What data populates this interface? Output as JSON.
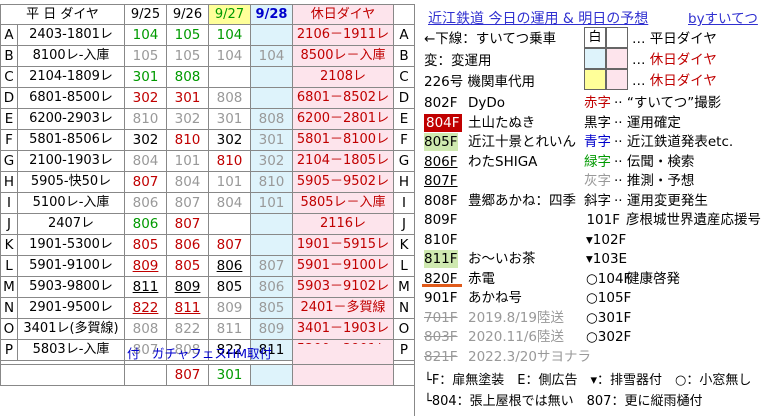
{
  "header": {
    "code": "平 日 ダイヤ",
    "d1": "9/25",
    "d2": "9/26",
    "d3": "9/27",
    "d4": "9/28",
    "holiday": "休日ダイヤ"
  },
  "rows": [
    {
      "code": "A",
      "train": "2403-1801レ",
      "v1": "104",
      "v2": "105",
      "v3": "104",
      "v4": "",
      "hol": "2106－1911レ",
      "side": "A",
      "c1": "gr",
      "c2": "gr",
      "c3": "gr",
      "u1": false,
      "u2": false,
      "u3": false,
      "hc": "r"
    },
    {
      "code": "B",
      "train": "8100レ-入庫",
      "v1": "105",
      "v2": "105",
      "v3": "104",
      "v4": "104",
      "hol": "8500レ－入庫",
      "side": "B",
      "c1": "g",
      "c2": "g",
      "c3": "g",
      "c4": "g",
      "u1": false,
      "u2": false,
      "u3": false,
      "hc": "r"
    },
    {
      "code": "C",
      "train": "2104-1809レ",
      "v1": "301",
      "v2": "808",
      "v3": "",
      "v4": "",
      "hol": "2108レ",
      "side": "C",
      "c1": "gr",
      "c2": "gr",
      "u1": false,
      "u2": false,
      "u3": false,
      "hc": "r"
    },
    {
      "code": "D",
      "train": "6801-8500レ",
      "v1": "302",
      "v2": "301",
      "v3": "808",
      "v4": "",
      "hol": "6801－8502レ",
      "side": "D",
      "c1": "r",
      "c2": "r",
      "c3": "g",
      "u1": false,
      "u2": false,
      "u3": false,
      "hc": "r"
    },
    {
      "code": "E",
      "train": "6200-2903レ",
      "v1": "810",
      "v2": "302",
      "v3": "301",
      "v4": "808",
      "hol": "6200－2801レ",
      "side": "E",
      "c1": "g",
      "c2": "g",
      "c3": "g",
      "c4": "g",
      "u1": false,
      "u2": false,
      "u3": false,
      "hc": "r"
    },
    {
      "code": "F",
      "train": "5801-8506レ",
      "v1": "302",
      "v2": "810",
      "v3": "302",
      "v4": "301",
      "hol": "5801－8100レ",
      "side": "F",
      "c1": "bk",
      "c2": "r",
      "c3": "bk",
      "c4": "g",
      "u1": false,
      "u2": false,
      "u3": false,
      "hc": "r"
    },
    {
      "code": "G",
      "train": "2100-1903レ",
      "v1": "804",
      "v2": "101",
      "v3": "810",
      "v4": "302",
      "hol": "2104－1805レ",
      "side": "G",
      "c1": "g",
      "c2": "g",
      "c3": "r",
      "c4": "g",
      "u1": false,
      "u2": false,
      "u3": false,
      "hc": "r"
    },
    {
      "code": "H",
      "train": "5905-快50レ",
      "v1": "807",
      "v2": "804",
      "v3": "101",
      "v4": "810",
      "hol": "5905－9502レ",
      "side": "H",
      "c1": "r",
      "c2": "g",
      "c3": "g",
      "c4": "g",
      "u1": false,
      "u2": false,
      "u3": false,
      "hc": "r"
    },
    {
      "code": "I",
      "train": "5100レ-入庫",
      "v1": "806",
      "v2": "807",
      "v3": "804",
      "v4": "101",
      "hol": "5805レ－入庫",
      "side": "I",
      "c1": "g",
      "c2": "g",
      "c3": "g",
      "c4": "g",
      "u1": false,
      "u2": false,
      "u3": false,
      "hc": "r"
    },
    {
      "code": "J",
      "train": "2407レ",
      "v1": "806",
      "v2": "807",
      "v3": "",
      "v4": "",
      "hol": "2116レ",
      "side": "J",
      "c1": "gr",
      "c2": "r",
      "u1": false,
      "u2": false,
      "u3": false,
      "hc": "r"
    },
    {
      "code": "K",
      "train": "1901-5300レ",
      "v1": "805",
      "v2": "806",
      "v3": "807",
      "v4": "",
      "hol": "1901－5915レ",
      "side": "K",
      "c1": "r",
      "c2": "r",
      "c3": "r",
      "u1": false,
      "u2": false,
      "u3": false,
      "hc": "r"
    },
    {
      "code": "L",
      "train": "5901-9100レ",
      "v1": "809",
      "v2": "805",
      "v3": "806",
      "v4": "807",
      "hol": "5901－9100レ",
      "side": "L",
      "c1": "r",
      "c2": "r",
      "c3": "bk",
      "c4": "g",
      "u1": true,
      "u2": false,
      "u3": true,
      "hc": "r"
    },
    {
      "code": "M",
      "train": "5903-9800レ",
      "v1": "811",
      "v2": "809",
      "v3": "805",
      "v4": "806",
      "hol": "5903－9102レ",
      "side": "M",
      "c1": "bk",
      "c2": "bk",
      "c3": "bk",
      "c4": "g",
      "u1": true,
      "u2": true,
      "u3": false,
      "hc": "r"
    },
    {
      "code": "N",
      "train": "2901-9500レ",
      "v1": "822",
      "v2": "811",
      "v3": "809",
      "v4": "805",
      "hol": "2401－多賀線",
      "side": "N",
      "c1": "r",
      "c2": "r",
      "c3": "g",
      "c4": "g",
      "u1": true,
      "u2": true,
      "u3": false,
      "hc": "r"
    },
    {
      "code": "O",
      "train": "3401レ(多賀線)",
      "v1": "808",
      "v2": "822",
      "v3": "811",
      "v4": "809",
      "hol": "3401－1903レ",
      "side": "O",
      "c1": "g",
      "c2": "g",
      "c3": "g",
      "c4": "g",
      "u1": false,
      "u2": false,
      "u3": false,
      "hc": "r"
    },
    {
      "code": "P",
      "train": "5803レ-入庫",
      "v1": "807",
      "v2": "808",
      "v3": "822",
      "v4": "811",
      "hol": "5200－2901レ",
      "side": "P",
      "c1": "g",
      "c2": "g",
      "c3": "bk",
      "c4": "bk",
      "u1": false,
      "u2": false,
      "u3": false,
      "hc": "r"
    }
  ],
  "footer_note": "付　ガチャフェスHM取付",
  "footer_vals": {
    "v2": "807",
    "v3": "301"
  },
  "right": {
    "title": "近江鉄道 今日の運用 & 明日の予想",
    "author": "byすいてつ",
    "legend": {
      "down": "←下線：すいてつ乗車",
      "change": "変：変運用",
      "sub": "226号 機関車代用",
      "shiro": "白",
      "weekday": "平日ダイヤ",
      "holiday1": "休日ダイヤ",
      "holiday2": "休日ダイヤ"
    },
    "cars": [
      {
        "num": "802F",
        "label": "DyDo"
      },
      {
        "num": "804F",
        "label": "土山たぬき"
      },
      {
        "num": "805F",
        "label": "近江十景とれいん"
      },
      {
        "num": "806F",
        "label": "わたSHIGA"
      },
      {
        "num": "807F",
        "label": ""
      },
      {
        "num": "808F",
        "label": "豊郷あかね：四季"
      },
      {
        "num": "809F",
        "label": ""
      },
      {
        "num": "810F",
        "label": ""
      },
      {
        "num": "811F",
        "label": "お〜いお茶"
      },
      {
        "num": "820F",
        "label": "赤電"
      },
      {
        "num": "901F",
        "label": "あかね号"
      },
      {
        "num": "701F",
        "label": "2019.8/19陸送"
      },
      {
        "num": "803F",
        "label": "2020.11/6陸送"
      },
      {
        "num": "821F",
        "label": "2022.3/20サヨナラ"
      }
    ],
    "colors": [
      {
        "key": "赤字",
        "desc": "“すいてつ”撮影"
      },
      {
        "key": "黒字",
        "desc": "運用確定"
      },
      {
        "key": "青字",
        "desc": "近江鉄道発表etc."
      },
      {
        "key": "緑字",
        "desc": "伝聞・検索"
      },
      {
        "key": "灰字",
        "desc": "推測・予想"
      },
      {
        "key": "斜字",
        "desc": "運用変更発生"
      }
    ],
    "series100": [
      {
        "num": "101F",
        "label": "彦根城世界遺産応援号"
      },
      {
        "num": "▾102F",
        "label": ""
      },
      {
        "num": "▾103E",
        "label": ""
      },
      {
        "num": "○104F",
        "label": "健康啓発"
      },
      {
        "num": "○105F",
        "label": ""
      },
      {
        "num": "○301F",
        "label": ""
      },
      {
        "num": "○302F",
        "label": ""
      }
    ],
    "notes": {
      "n1": "└F：扉無塗装　E：側広告　▾：排雪器付　○：小窓無し",
      "n2": "└804：張上屋根では無い　807：更に縦雨樋付"
    }
  }
}
